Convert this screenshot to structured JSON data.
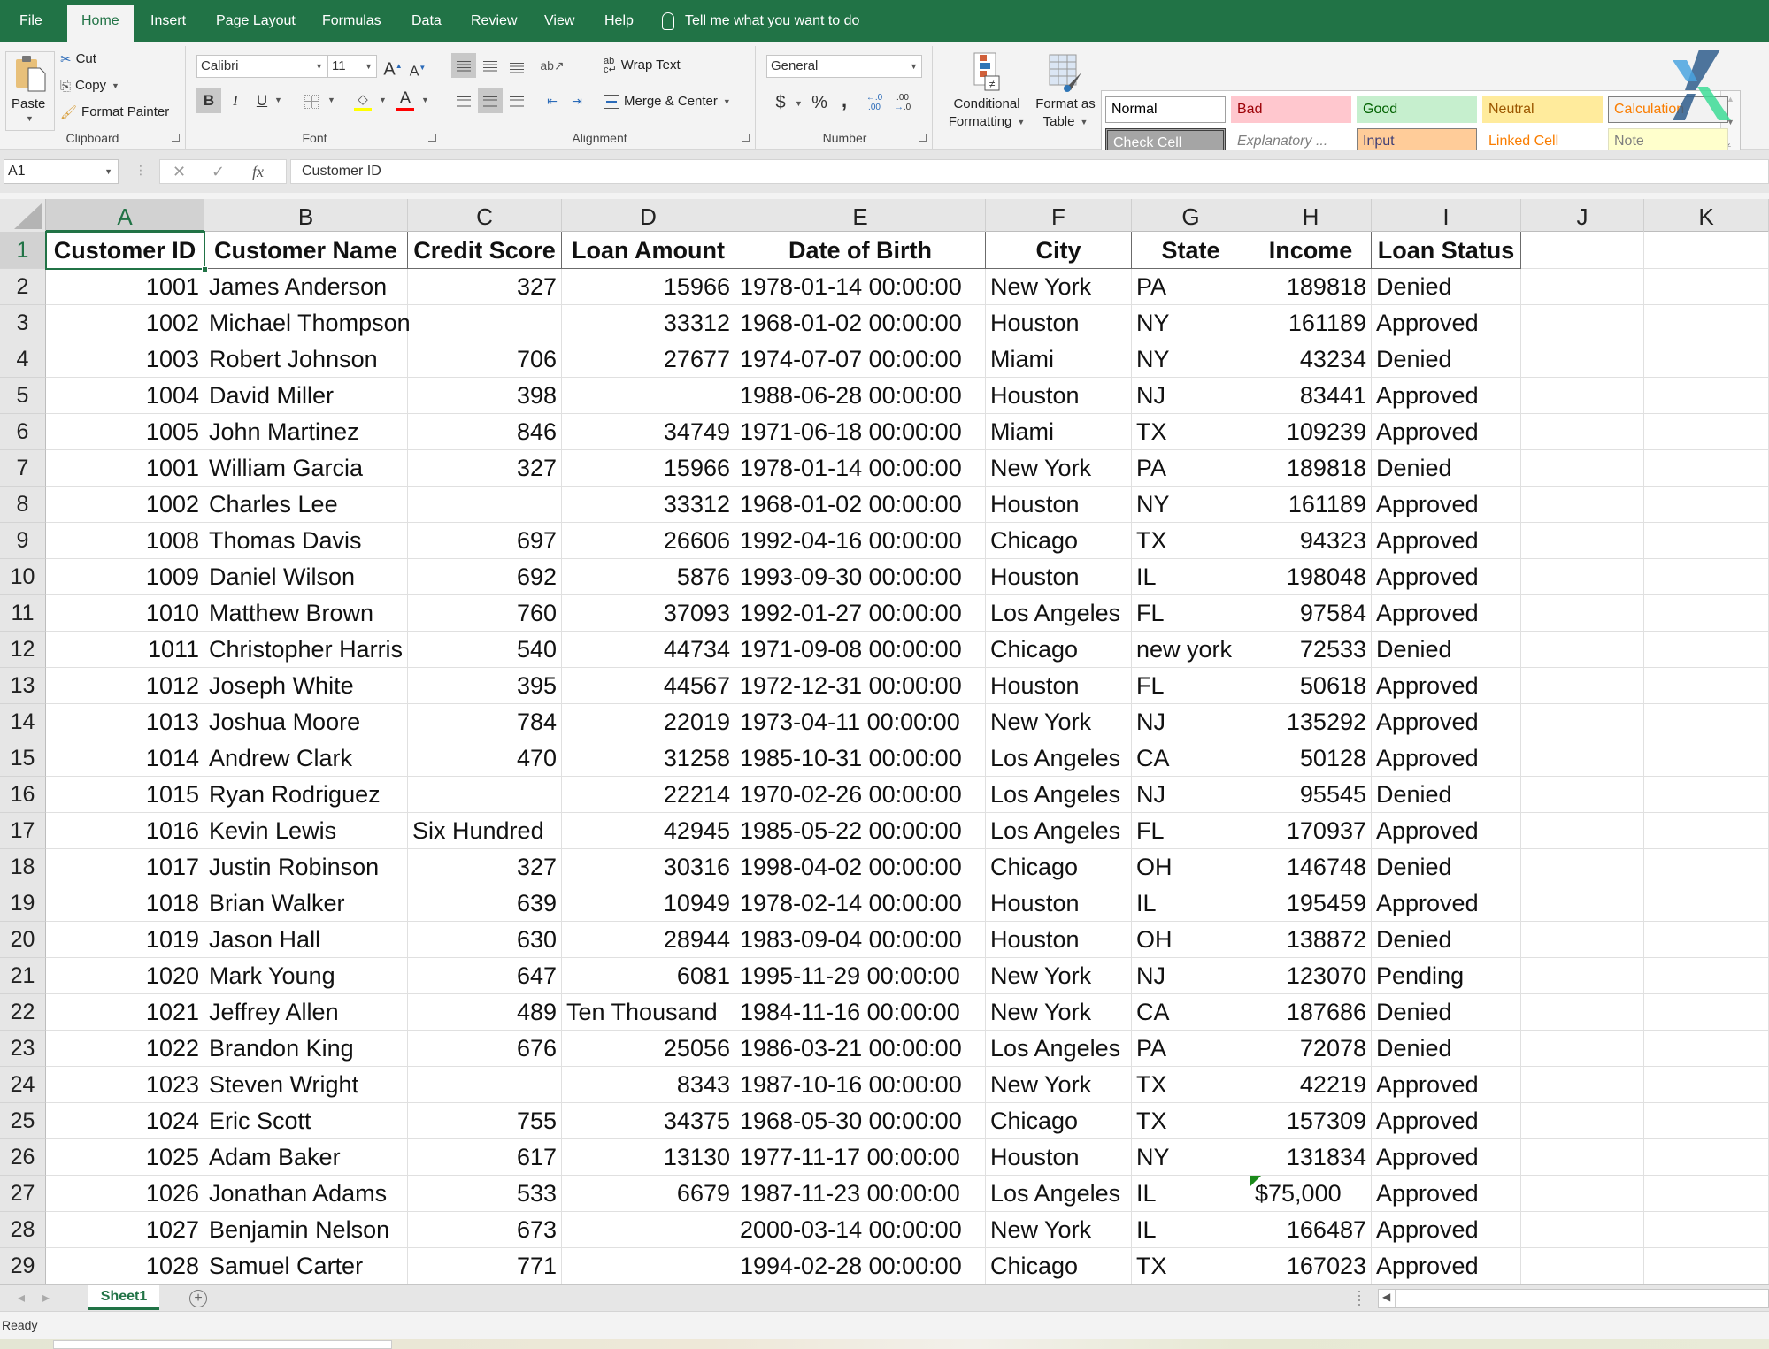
{
  "menu": {
    "tabs": [
      "File",
      "Home",
      "Insert",
      "Page Layout",
      "Formulas",
      "Data",
      "Review",
      "View",
      "Help"
    ],
    "active_tab": "Home",
    "tell_me": "Tell me what you want to do"
  },
  "ribbon": {
    "clipboard": {
      "label": "Clipboard",
      "paste": "Paste",
      "cut": "Cut",
      "copy": "Copy",
      "format_painter": "Format Painter"
    },
    "font": {
      "label": "Font",
      "font_name": "Calibri",
      "font_size": "11",
      "bold": "B",
      "italic": "I",
      "underline": "U",
      "grow": "A",
      "shrink": "A",
      "font_color": "A",
      "fill_color_hex": "#ffff00",
      "font_color_hex": "#ff0000"
    },
    "alignment": {
      "label": "Alignment",
      "wrap_text": "Wrap Text",
      "merge_center": "Merge & Center"
    },
    "number": {
      "label": "Number",
      "format": "General",
      "currency": "$",
      "percent": "%",
      "comma": ",",
      "inc_decimal": "←.0 .00",
      "dec_decimal": ".00 →.0"
    },
    "styles": {
      "label": "Styles",
      "conditional_formatting": [
        "Conditional",
        "Formatting"
      ],
      "format_as_table": [
        "Format as",
        "Table"
      ],
      "cells": [
        {
          "label": "Normal",
          "bg": "#ffffff",
          "fg": "#000000",
          "border": "#a0a0a0"
        },
        {
          "label": "Bad",
          "bg": "#ffc7ce",
          "fg": "#9c0006",
          "border": "#ffc7ce"
        },
        {
          "label": "Good",
          "bg": "#c6efce",
          "fg": "#006100",
          "border": "#c6efce"
        },
        {
          "label": "Neutral",
          "bg": "#ffeb9c",
          "fg": "#9c5700",
          "border": "#ffeb9c"
        },
        {
          "label": "Calculation",
          "bg": "#f2f2f2",
          "fg": "#fa7d00",
          "border": "#7f7f7f"
        },
        {
          "label": "Check Cell",
          "bg": "#a5a5a5",
          "fg": "#ffffff",
          "border": "#3f3f3f"
        },
        {
          "label": "Explanatory ...",
          "bg": "#ffffff",
          "fg": "#7f7f7f",
          "border": "#ffffff"
        },
        {
          "label": "Input",
          "bg": "#ffcc99",
          "fg": "#3f3f76",
          "border": "#7f7f7f"
        },
        {
          "label": "Linked Cell",
          "bg": "#ffffff",
          "fg": "#fa7d00",
          "border": "#ffffff"
        },
        {
          "label": "Note",
          "bg": "#ffffcc",
          "fg": "#7f7f7f",
          "border": "#e0e0c0"
        }
      ]
    }
  },
  "formula_bar": {
    "name_box": "A1",
    "cancel": "✕",
    "enter": "✓",
    "fx": "fx",
    "content": "Customer ID"
  },
  "sheet": {
    "columns": [
      "A",
      "B",
      "C",
      "D",
      "E",
      "F",
      "G",
      "H",
      "I",
      "J",
      "K"
    ],
    "selected_cell": "A1",
    "headers": [
      "Customer ID",
      "Customer Name",
      "Credit Score",
      "Loan Amount",
      "Date of Birth",
      "City",
      "State",
      "Income",
      "Loan Status"
    ],
    "rows": [
      [
        "1001",
        "James Anderson",
        "327",
        "15966",
        "1978-01-14 00:00:00",
        "New York",
        "PA",
        "189818",
        "Denied"
      ],
      [
        "1002",
        "Michael Thompson",
        "",
        "33312",
        "1968-01-02 00:00:00",
        "Houston",
        "NY",
        "161189",
        "Approved"
      ],
      [
        "1003",
        "Robert Johnson",
        "706",
        "27677",
        "1974-07-07 00:00:00",
        "Miami",
        "NY",
        "43234",
        "Denied"
      ],
      [
        "1004",
        "David Miller",
        "398",
        "",
        "1988-06-28 00:00:00",
        "Houston",
        "NJ",
        "83441",
        "Approved"
      ],
      [
        "1005",
        "John Martinez",
        "846",
        "34749",
        "1971-06-18 00:00:00",
        "Miami",
        "TX",
        "109239",
        "Approved"
      ],
      [
        "1001",
        "William Garcia",
        "327",
        "15966",
        "1978-01-14 00:00:00",
        "New York",
        "PA",
        "189818",
        "Denied"
      ],
      [
        "1002",
        "Charles Lee",
        "",
        "33312",
        "1968-01-02 00:00:00",
        "Houston",
        "NY",
        "161189",
        "Approved"
      ],
      [
        "1008",
        "Thomas Davis",
        "697",
        "26606",
        "1992-04-16 00:00:00",
        "Chicago",
        "TX",
        "94323",
        "Approved"
      ],
      [
        "1009",
        "Daniel Wilson",
        "692",
        "5876",
        "1993-09-30 00:00:00",
        "Houston",
        "IL",
        "198048",
        "Approved"
      ],
      [
        "1010",
        "Matthew Brown",
        "760",
        "37093",
        "1992-01-27 00:00:00",
        "Los Angeles",
        "FL",
        "97584",
        "Approved"
      ],
      [
        "1011",
        "Christopher Harris",
        "540",
        "44734",
        "1971-09-08 00:00:00",
        "Chicago",
        "new york",
        "72533",
        "Denied"
      ],
      [
        "1012",
        "Joseph White",
        "395",
        "44567",
        "1972-12-31 00:00:00",
        "Houston",
        "FL",
        "50618",
        "Approved"
      ],
      [
        "1013",
        "Joshua Moore",
        "784",
        "22019",
        "1973-04-11 00:00:00",
        "New York",
        "NJ",
        "135292",
        "Approved"
      ],
      [
        "1014",
        "Andrew Clark",
        "470",
        "31258",
        "1985-10-31 00:00:00",
        "Los Angeles",
        "CA",
        "50128",
        "Approved"
      ],
      [
        "1015",
        "Ryan Rodriguez",
        "",
        "22214",
        "1970-02-26 00:00:00",
        "Los Angeles",
        "NJ",
        "95545",
        "Denied"
      ],
      [
        "1016",
        "Kevin Lewis",
        "Six Hundred",
        "42945",
        "1985-05-22 00:00:00",
        "Los Angeles",
        "FL",
        "170937",
        "Approved"
      ],
      [
        "1017",
        "Justin Robinson",
        "327",
        "30316",
        "1998-04-02 00:00:00",
        "Chicago",
        "OH",
        "146748",
        "Denied"
      ],
      [
        "1018",
        "Brian Walker",
        "639",
        "10949",
        "1978-02-14 00:00:00",
        "Houston",
        "IL",
        "195459",
        "Approved"
      ],
      [
        "1019",
        "Jason Hall",
        "630",
        "28944",
        "1983-09-04 00:00:00",
        "Houston",
        "OH",
        "138872",
        "Denied"
      ],
      [
        "1020",
        "Mark Young",
        "647",
        "6081",
        "1995-11-29 00:00:00",
        "New York",
        "NJ",
        "123070",
        "Pending"
      ],
      [
        "1021",
        "Jeffrey Allen",
        "489",
        "Ten Thousand",
        "1984-11-16 00:00:00",
        "New York",
        "CA",
        "187686",
        "Denied"
      ],
      [
        "1022",
        "Brandon King",
        "676",
        "25056",
        "1986-03-21 00:00:00",
        "Los Angeles",
        "PA",
        "72078",
        "Denied"
      ],
      [
        "1023",
        "Steven Wright",
        "",
        "8343",
        "1987-10-16 00:00:00",
        "New York",
        "TX",
        "42219",
        "Approved"
      ],
      [
        "1024",
        "Eric Scott",
        "755",
        "34375",
        "1968-05-30 00:00:00",
        "Chicago",
        "TX",
        "157309",
        "Approved"
      ],
      [
        "1025",
        "Adam Baker",
        "617",
        "13130",
        "1977-11-17 00:00:00",
        "Houston",
        "NY",
        "131834",
        "Approved"
      ],
      [
        "1026",
        "Jonathan Adams",
        "533",
        "6679",
        "1987-11-23 00:00:00",
        "Los Angeles",
        "IL",
        "$75,000",
        "Approved"
      ],
      [
        "1027",
        "Benjamin Nelson",
        "673",
        "",
        "2000-03-14 00:00:00",
        "New York",
        "IL",
        "166487",
        "Approved"
      ],
      [
        "1028",
        "Samuel Carter",
        "771",
        "",
        "1994-02-28 00:00:00",
        "Chicago",
        "TX",
        "167023",
        "Approved"
      ]
    ],
    "text_as_number_warning_cell": "H27"
  },
  "sheet_tabs": {
    "tabs": [
      "Sheet1"
    ],
    "active": "Sheet1",
    "add_label": "+"
  },
  "status": {
    "text": "Ready"
  },
  "theme": {
    "accent": "#217346"
  }
}
